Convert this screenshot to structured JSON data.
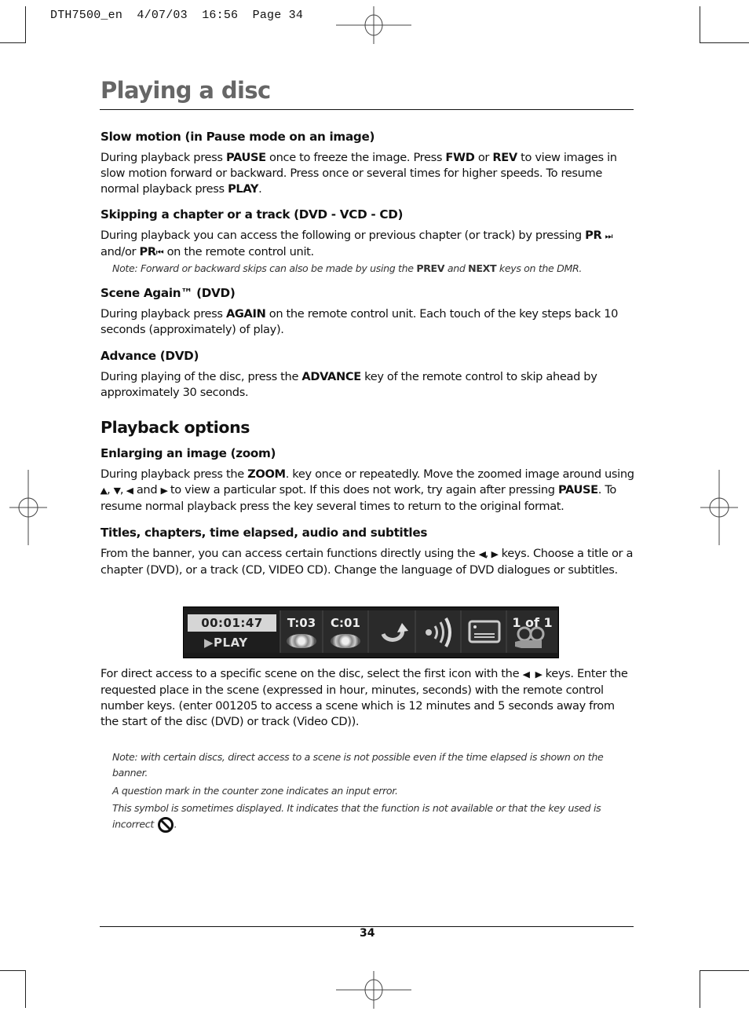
{
  "slug": "DTH7500_en  4/07/03  16:56  Page 34",
  "page_title": "Playing a disc",
  "sections": {
    "slow_motion": {
      "heading": "Slow motion (in Pause mode on an image)",
      "t1": "During playback press ",
      "k1": "PAUSE",
      "t2": " once to freeze the image. Press ",
      "k2": "FWD",
      "t3": " or ",
      "k3": "REV",
      "t4": " to view images in slow motion forward or backward. Press once or several times for higher speeds. To resume normal playback press ",
      "k4": "PLAY",
      "t5": "."
    },
    "skipping": {
      "heading": "Skipping a chapter or a track (DVD - VCD - CD)",
      "t1": "During playback you can access the following or previous chapter (or track) by pressing ",
      "k1": "PR",
      "next_icon": "⏭",
      "t2": " and/or ",
      "k2": "PR",
      "prev_icon": "⏮",
      "t3": " on the remote control unit.",
      "note_t1": "Note: Forward or backward skips can also be made by using the ",
      "note_k1": "PREV",
      "note_t2": " and ",
      "note_k2": "NEXT",
      "note_t3": " keys on the DMR."
    },
    "scene_again": {
      "heading": "Scene Again™ (DVD)",
      "t1": "During playback press ",
      "k1": "AGAIN",
      "t2": " on the remote control unit. Each touch of the key steps back 10 seconds (approximately) of play)."
    },
    "advance": {
      "heading": "Advance (DVD)",
      "t1": "During playing of the disc, press the ",
      "k1": "ADVANCE",
      "t2": " key of the remote control to skip ahead by approximately 30 seconds."
    },
    "playback_options": {
      "heading": "Playback options"
    },
    "zoom": {
      "heading": "Enlarging an image (zoom)",
      "t1": "During playback press the ",
      "k1": "ZOOM",
      "t2": ". key once or repeatedly. Move the zoomed image around using ",
      "up": "▲",
      "down": "▼",
      "left": "◀",
      "right": "▶",
      "and": " and ",
      "t3": " to view a particular spot. If this does not work, try again after pressing ",
      "k2": "PAUSE",
      "t4": ". To resume normal playback press the key several times to return to the original format."
    },
    "titles": {
      "heading": "Titles, chapters, time elapsed, audio and subtitles",
      "t1": "From the banner, you can access certain functions directly using the ",
      "left": "◀",
      "right": "▶",
      "t2": " keys. Choose a title or a chapter (DVD), or a track (CD, VIDEO CD). Change the language of DVD dialogues or subtitles."
    },
    "direct_access": {
      "t1": "For direct access to a specific scene on the disc, select the first icon with the ",
      "left": "◀",
      "right": "▶",
      "t2": " keys. Enter the requested place in the scene (expressed in hour, minutes, seconds) with the remote control number keys. (enter 001205 to access a scene which is 12 minutes and 5 seconds away from the start of the disc (DVD) or track (Video CD))."
    },
    "notes": {
      "n1": "Note: with certain discs, direct access to a scene is not possible even if the time elapsed is shown on the banner.",
      "n2": "A question mark in the counter zone indicates an input error.",
      "n3": "This symbol is sometimes displayed. It indicates that the function is not available or that the key used is incorrect",
      "n3_end": "."
    }
  },
  "banner": {
    "time": "00:01:47",
    "status": "PLAY",
    "title": "T:03",
    "chapter": "C:01",
    "subtitle_count": "1 of 1",
    "icons": [
      "disc-icon",
      "repeat-icon",
      "audio-icon",
      "subtitle-icon",
      "camera-angle-icon"
    ]
  },
  "page_number": "34"
}
